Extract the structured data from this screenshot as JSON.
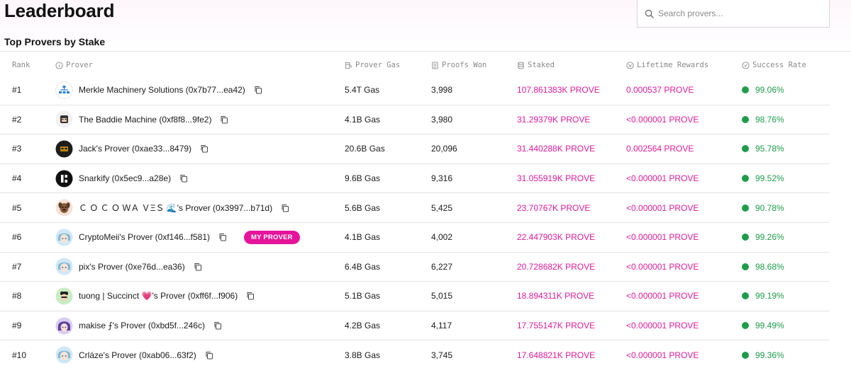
{
  "page": {
    "title": "Leaderboard",
    "subtitle": "Top Provers by Stake"
  },
  "search": {
    "placeholder": "Search provers..."
  },
  "columns": {
    "rank": "Rank",
    "prover": "Prover",
    "gas": "Prover Gas",
    "proofs": "Proofs Won",
    "staked": "Staked",
    "rewards": "Lifetime Rewards",
    "rate": "Success Rate"
  },
  "colors": {
    "accent": "#e01b9b",
    "success": "#1e9c4a"
  },
  "rows": [
    {
      "rank": "#1",
      "prover": "Merkle Machinery Solutions (0x7b77...ea42)",
      "gas": "5.4T Gas",
      "proofs": "3,998",
      "staked": "107.861383K PROVE",
      "rewards": "0.000537 PROVE",
      "rate": "99.06%",
      "avatar": "network-logo-icon"
    },
    {
      "rank": "#2",
      "prover": "The Baddie Machine (0xf8f8...9fe2)",
      "gas": "4.1B Gas",
      "proofs": "3,980",
      "staked": "31.29379K PROVE",
      "rewards": "<0.000001 PROVE",
      "rate": "98.76%",
      "avatar": "character-avatar-icon"
    },
    {
      "rank": "#3",
      "prover": "Jack's Prover (0xae33...8479)",
      "gas": "20.6B Gas",
      "proofs": "20,096",
      "staked": "31.440288K PROVE",
      "rewards": "0.002564 PROVE",
      "rate": "95.78%",
      "avatar": "dark-character-avatar-icon"
    },
    {
      "rank": "#4",
      "prover": "Snarkify (0x5ec9...a28e)",
      "gas": "9.6B Gas",
      "proofs": "9,316",
      "staked": "31.055919K PROVE",
      "rewards": "<0.000001 PROVE",
      "rate": "99.52%",
      "avatar": "snarkify-logo-icon"
    },
    {
      "rank": "#5",
      "prover": "Ｃ Ｏ Ｃ Ｏ ＷＡ ＶΞＳ 🌊's Prover (0x3997...b71d)",
      "gas": "5.6B Gas",
      "proofs": "5,425",
      "staked": "23.70767K PROVE",
      "rewards": "<0.000001 PROVE",
      "rate": "90.78%",
      "avatar": "dog-avatar-icon"
    },
    {
      "rank": "#6",
      "prover": "CryptoMeii's Prover (0xf146...f581)",
      "gas": "4.1B Gas",
      "proofs": "4,002",
      "staked": "22.447903K PROVE",
      "rewards": "<0.000001 PROVE",
      "rate": "99.26%",
      "avatar": "anime-avatar-icon",
      "badge": "MY PROVER"
    },
    {
      "rank": "#7",
      "prover": "pix's Prover (0xe76d...ea36)",
      "gas": "6.4B Gas",
      "proofs": "6,227",
      "staked": "20.728682K PROVE",
      "rewards": "<0.000001 PROVE",
      "rate": "98.68%",
      "avatar": "anime-avatar-icon"
    },
    {
      "rank": "#8",
      "prover": "tuong | Succinct 💗's Prover (0xff6f...f906)",
      "gas": "5.1B Gas",
      "proofs": "5,015",
      "staked": "18.894311K PROVE",
      "rewards": "<0.000001 PROVE",
      "rate": "99.19%",
      "avatar": "green-character-avatar-icon"
    },
    {
      "rank": "#9",
      "prover": "makise ⨍'s Prover (0xbd5f...246c)",
      "gas": "4.2B Gas",
      "proofs": "4,117",
      "staked": "17.755147K PROVE",
      "rewards": "<0.000001 PROVE",
      "rate": "99.49%",
      "avatar": "purple-anime-avatar-icon"
    },
    {
      "rank": "#10",
      "prover": "Crláze's Prover (0xab06...63f2)",
      "gas": "3.8B Gas",
      "proofs": "3,745",
      "staked": "17.648821K PROVE",
      "rewards": "<0.000001 PROVE",
      "rate": "99.36%",
      "avatar": "anime-avatar-icon"
    }
  ]
}
